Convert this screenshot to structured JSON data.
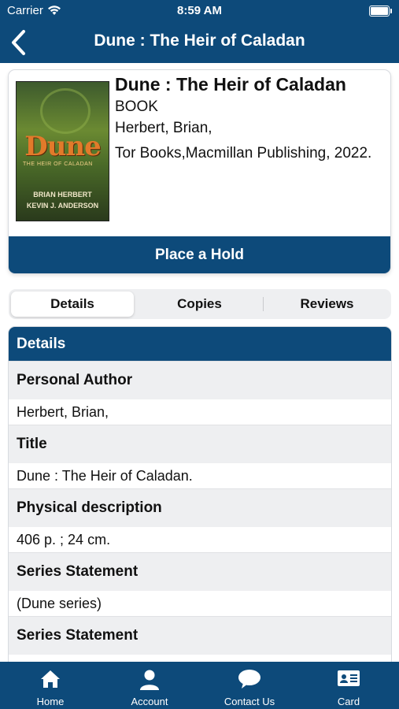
{
  "status_bar": {
    "carrier": "Carrier",
    "time": "8:59 AM"
  },
  "nav": {
    "title": "Dune : The Heir of Caladan"
  },
  "book": {
    "title": "Dune : The Heir of Caladan",
    "format": "BOOK",
    "author": "Herbert, Brian,",
    "publisher": "Tor Books,Macmillan Publishing, 2022.",
    "cover": {
      "main_title": "Dune",
      "subtitle": "THE HEIR OF CALADAN",
      "author1": "BRIAN HERBERT",
      "author2": "KEVIN J. ANDERSON"
    },
    "hold_label": "Place a Hold"
  },
  "tabs": [
    {
      "label": "Details",
      "active": true
    },
    {
      "label": "Copies",
      "active": false
    },
    {
      "label": "Reviews",
      "active": false
    }
  ],
  "details": {
    "header": "Details",
    "rows": [
      {
        "label": "Personal Author",
        "value": "Herbert, Brian,"
      },
      {
        "label": "Title",
        "value": "Dune : The Heir of Caladan."
      },
      {
        "label": "Physical description",
        "value": "406 p. ; 24 cm."
      },
      {
        "label": "Series Statement",
        "value": "(Dune series)"
      },
      {
        "label": "Series Statement",
        "value": ""
      }
    ]
  },
  "tabbar": [
    {
      "label": "Home",
      "icon": "home-icon"
    },
    {
      "label": "Account",
      "icon": "person-icon"
    },
    {
      "label": "Contact Us",
      "icon": "chat-bubble-icon"
    },
    {
      "label": "Card",
      "icon": "id-card-icon"
    }
  ],
  "colors": {
    "primary": "#0d4a7a",
    "row_bg": "#eeeff1",
    "cover_orange": "#e27a2a"
  }
}
